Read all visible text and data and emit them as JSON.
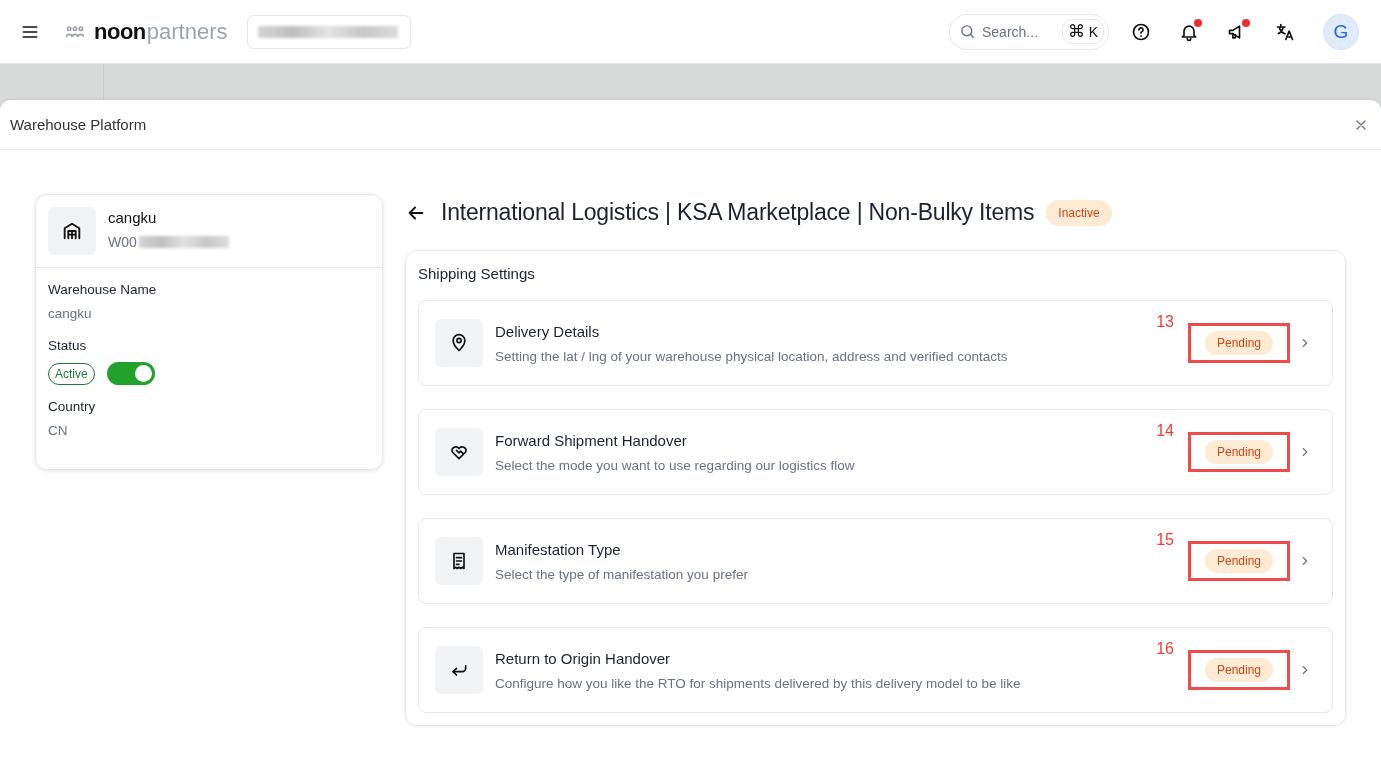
{
  "topbar": {
    "brand_word": "noon",
    "brand_suffix": "partners",
    "account_selector": {
      "redacted": true
    },
    "search": {
      "placeholder": "Search...",
      "shortcut_symbol": "⌘",
      "shortcut_key": "K"
    },
    "notifications_unread": true,
    "announcements_unread": true,
    "avatar_initial": "G"
  },
  "modal": {
    "title": "Warehouse Platform"
  },
  "warehouse": {
    "name": "cangku",
    "code": "W00",
    "code_redacted": true,
    "fields": [
      {
        "kind": "text",
        "label": "Warehouse Name",
        "value": "cangku"
      },
      {
        "kind": "status",
        "label": "Status",
        "value": "Active",
        "on": true
      },
      {
        "kind": "text",
        "label": "Country",
        "value": "CN"
      }
    ]
  },
  "model": {
    "title": "International Logistics | KSA Marketplace | Non-Bulky Items",
    "status": "Inactive"
  },
  "shipping_settings": {
    "title": "Shipping Settings",
    "items": [
      {
        "title": "Delivery Details",
        "description": "Setting the lat / lng of your warehouse physical location, address and verified contacts",
        "status": "Pending",
        "annotation": "13"
      },
      {
        "title": "Forward Shipment Handover",
        "description": "Select the mode you want to use regarding our logistics flow",
        "status": "Pending",
        "annotation": "14"
      },
      {
        "title": "Manifestation Type",
        "description": "Select the type of manifestation you prefer",
        "status": "Pending",
        "annotation": "15"
      },
      {
        "title": "Return to Origin Handover",
        "description": "Configure how you like the RTO for shipments delivered by this delivery model to be like",
        "status": "Pending",
        "annotation": "16"
      }
    ]
  }
}
